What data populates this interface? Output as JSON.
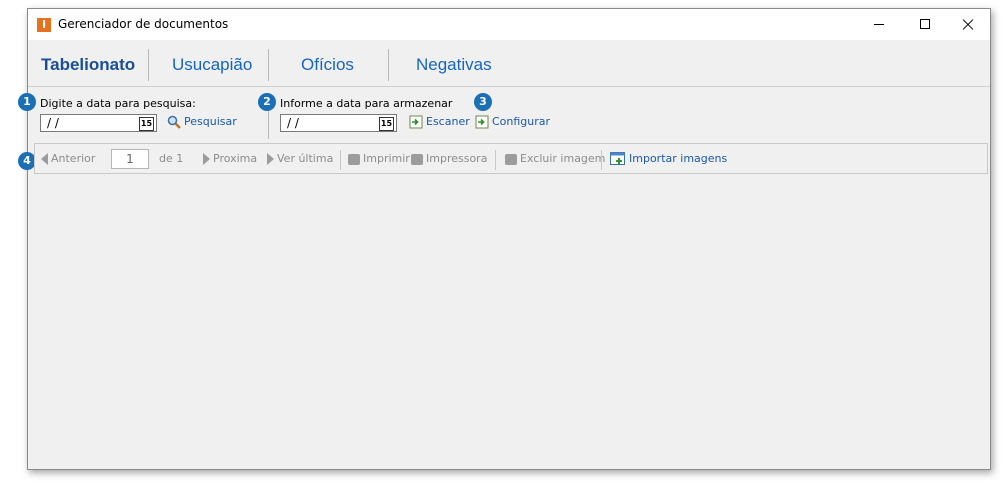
{
  "window": {
    "title": "Gerenciador de documentos",
    "app_icon_letter": "I"
  },
  "tabs": [
    {
      "label": "Tabelionato",
      "active": true
    },
    {
      "label": "Usucapião",
      "active": false
    },
    {
      "label": "Ofícios",
      "active": false
    },
    {
      "label": "Negativas",
      "active": false
    }
  ],
  "search": {
    "badge": "1",
    "label": "Digite a data para pesquisa:",
    "date_value": "/ /",
    "calendar_glyph": "15",
    "button_label": "Pesquisar"
  },
  "store": {
    "badge": "2",
    "label": "Informe a data para armazenar",
    "date_value": "/ /",
    "calendar_glyph": "15",
    "scan_label": "Escaner",
    "configure_badge": "3",
    "configure_label": "Configurar"
  },
  "toolbar": {
    "badge": "4",
    "previous_label": "Anterior",
    "page_value": "1",
    "page_of": "de 1",
    "next_label": "Proxima",
    "last_label": "Ver última",
    "print_label": "Imprimir",
    "printer_label": "Impressora",
    "delete_label": "Excluir imagem",
    "import_label": "Importar imagens"
  },
  "colors": {
    "badge": "#1b6fb5",
    "link": "#1a5aa8",
    "tab_active": "#1a4e96",
    "app_icon": "#e6711e",
    "disabled": "#8c8c8c"
  }
}
